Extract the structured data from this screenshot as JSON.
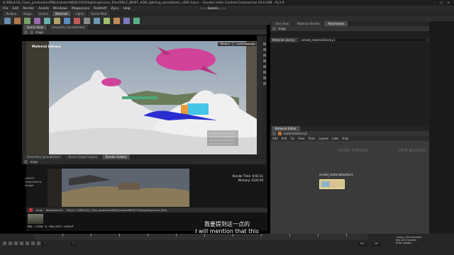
{
  "window": {
    "title": "K:/RBL/LSS_Class_production/RBL/Lshots/ABED/1920/lighting/scene_files/RBL2_BRIEF_ADD_lighting_aerodetails_v001.hipnc - Houdini Indie Limited-Commercial 19.0.498 - Py3.9"
  },
  "menu": {
    "items": [
      "File",
      "Edit",
      "Render",
      "Assets",
      "Windows",
      "Megascans",
      "Redshift",
      "Zync",
      "Help"
    ],
    "desktop": "Solaris"
  },
  "shelf_tabs": [
    "Toolbox",
    "Stage",
    "Solaris",
    "Materials",
    "Lights",
    "Scene Mod"
  ],
  "viewport_pane": {
    "tabs": [
      "Scene View",
      "Geometry Spreadsheet"
    ],
    "path": "stage",
    "label": "Material Library",
    "buttons": {
      "persp": "Persp ▾",
      "cam": "CameraBackgroundPlate ▾"
    }
  },
  "lower_pane": {
    "tabs": [
      "Geometry Spreadsheet",
      "Scene Graph Layers",
      "Render Gallery"
    ],
    "path": "stage",
    "render_time": "Render Time: 0:02:11",
    "memory": "Memory: 4120.59",
    "left_info": [
      "LAYOUT",
      "TextureCache",
      "Images"
    ],
    "bar_label": "Snap",
    "background": "Background ▾",
    "source": "Source: F:/RBL/LSS_Class_production/RBL/Lshots/ABED/1920/lighting/scene_files/..."
  },
  "thumbnails": [
    {
      "label": "RBL · C7408 · A · May 2022 · LAYOUT"
    }
  ],
  "right_panel": {
    "top_tabs": [
      "Tree View",
      "Material Palette",
      "Parameters"
    ],
    "node_type": "Material Library",
    "node_name": "arnold_materialLibrary1",
    "net_tabs": [
      "Network Editor"
    ],
    "net_path": "materialLibrary1",
    "net_menu": [
      "Add",
      "Edit",
      "Go",
      "View",
      "Tools",
      "Layout",
      "Labs",
      "Help"
    ],
    "watermark_left": "Indie Edition",
    "watermark_right": "VEX Builder",
    "node_label": "arnold_materialbuilder1"
  },
  "timeline": {
    "start": "1",
    "current": "1",
    "end_a": "240",
    "end_b": "240",
    "right_labels": [
      "1 keys, 0/0 channels",
      "Key All Channels",
      "Auto Update"
    ]
  },
  "subtitles": {
    "chinese": "我要提到这一点的",
    "english": "I will mention that this"
  },
  "colors": {
    "node_fill": "#d9c48f",
    "creature_magenta": "#d1439b",
    "creature_blue": "#2a2ed0",
    "prop_orange": "#e89a3a",
    "prop_cyan": "#45c6e8"
  }
}
